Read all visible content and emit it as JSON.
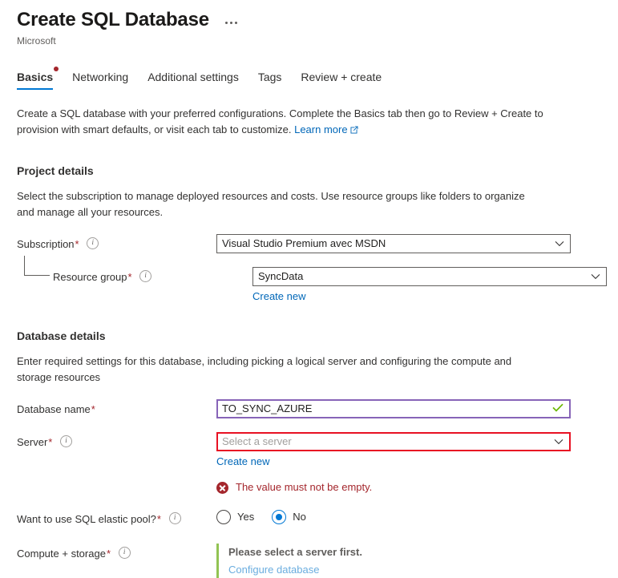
{
  "header": {
    "title": "Create SQL Database",
    "subtitle": "Microsoft",
    "ellipsis_label": "..."
  },
  "tabs": [
    {
      "label": "Basics",
      "active": true,
      "has_dot": true
    },
    {
      "label": "Networking",
      "active": false,
      "has_dot": false
    },
    {
      "label": "Additional settings",
      "active": false,
      "has_dot": false
    },
    {
      "label": "Tags",
      "active": false,
      "has_dot": false
    },
    {
      "label": "Review + create",
      "active": false,
      "has_dot": false
    }
  ],
  "intro": {
    "text": "Create a SQL database with your preferred configurations. Complete the Basics tab then go to Review + Create to provision with smart defaults, or visit each tab to customize. ",
    "link_label": "Learn more"
  },
  "project_details": {
    "title": "Project details",
    "description": "Select the subscription to manage deployed resources and costs. Use resource groups like folders to organize and manage all your resources.",
    "subscription": {
      "label": "Subscription",
      "required": "*",
      "value": "Visual Studio Premium avec MSDN"
    },
    "resource_group": {
      "label": "Resource group",
      "required": "*",
      "value": "SyncData",
      "create_new_label": "Create new"
    }
  },
  "database_details": {
    "title": "Database details",
    "description": "Enter required settings for this database, including picking a logical server and configuring the compute and storage resources",
    "database_name": {
      "label": "Database name",
      "required": "*",
      "value": "TO_SYNC_AZURE",
      "valid": true
    },
    "server": {
      "label": "Server",
      "required": "*",
      "placeholder": "Select a server",
      "create_new_label": "Create new",
      "error_message": "The value must not be empty."
    },
    "elastic_pool": {
      "label": "Want to use SQL elastic pool?",
      "required": "*",
      "options": [
        {
          "label": "Yes",
          "selected": false
        },
        {
          "label": "No",
          "selected": true
        }
      ]
    },
    "compute_storage": {
      "label": "Compute + storage",
      "required": "*",
      "status_text": "Please select a server first.",
      "configure_link": "Configure database"
    }
  },
  "colors": {
    "accent_blue": "#0078d4",
    "link_blue": "#0067b8",
    "error_red": "#a4262c",
    "error_border": "#e81123",
    "focus_purple": "#8764b8",
    "success_green": "#6bb700",
    "panel_green": "#92c353"
  },
  "icons": {
    "info": "info-icon",
    "chevron_down": "chevron-down-icon",
    "external_link": "external-link-icon",
    "check": "check-icon",
    "error": "error-circle-icon"
  }
}
